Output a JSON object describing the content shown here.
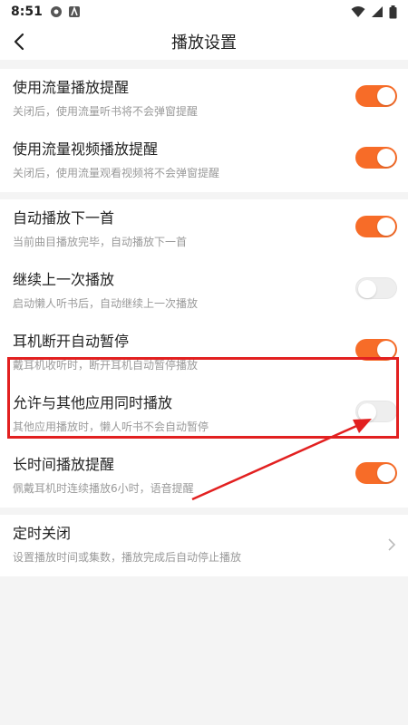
{
  "status_bar": {
    "time": "8:51"
  },
  "header": {
    "title": "播放设置"
  },
  "group1": [
    {
      "title": "使用流量播放提醒",
      "desc": "关闭后，使用流量听书将不会弹窗提醒",
      "toggle": "on"
    },
    {
      "title": "使用流量视频播放提醒",
      "desc": "关闭后，使用流量观看视频将不会弹窗提醒",
      "toggle": "on"
    }
  ],
  "group2": [
    {
      "title": "自动播放下一首",
      "desc": "当前曲目播放完毕，自动播放下一首",
      "toggle": "on"
    },
    {
      "title": "继续上一次播放",
      "desc": "启动懒人听书后，自动继续上一次播放",
      "toggle": "off"
    },
    {
      "title": "耳机断开自动暂停",
      "desc": "戴耳机收听时，断开耳机自动暂停播放",
      "toggle": "on"
    },
    {
      "title": "允许与其他应用同时播放",
      "desc": "其他应用播放时，懒人听书不会自动暂停",
      "toggle": "off"
    },
    {
      "title": "长时间播放提醒",
      "desc": "佩戴耳机时连续播放6小时，语音提醒",
      "toggle": "on"
    }
  ],
  "group3": [
    {
      "title": "定时关闭",
      "desc": "设置播放时间或集数，播放完成后自动停止播放"
    }
  ],
  "colors": {
    "accent": "#f76c28",
    "highlight": "#e22020"
  }
}
